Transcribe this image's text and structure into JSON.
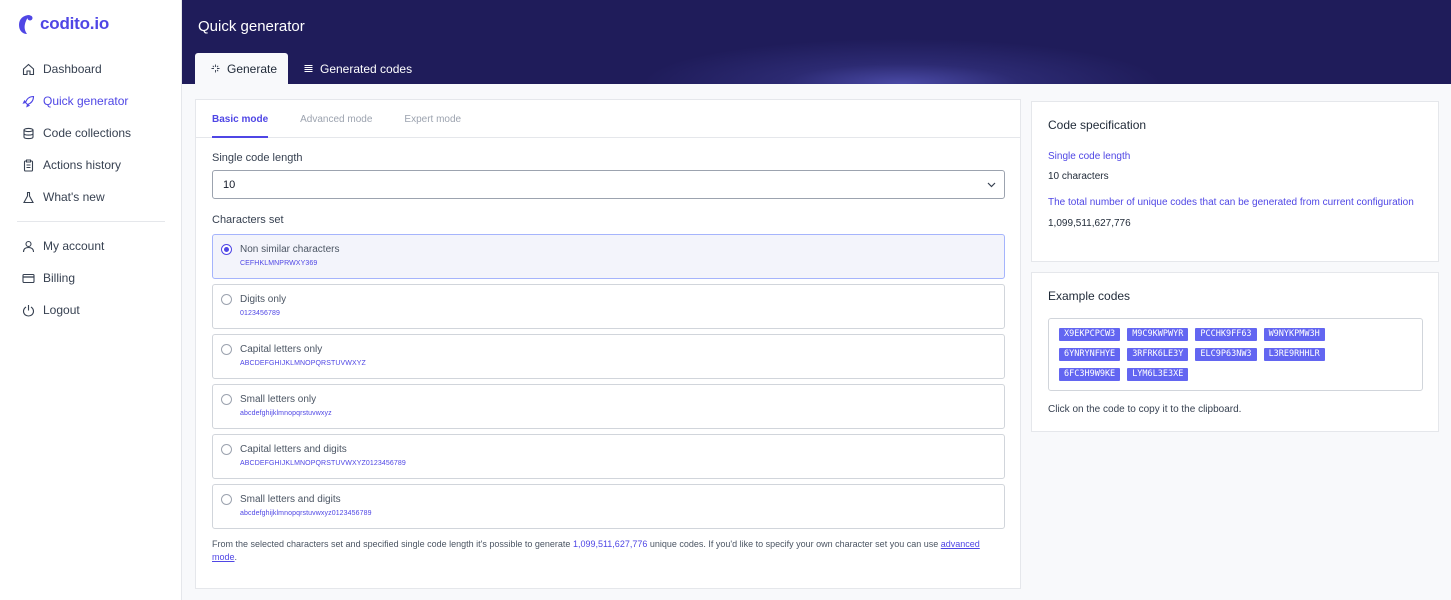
{
  "app": {
    "logo": "codito.io"
  },
  "sidebar": {
    "items": [
      {
        "label": "Dashboard",
        "icon": "home-icon"
      },
      {
        "label": "Quick generator",
        "icon": "rocket-icon",
        "active": true
      },
      {
        "label": "Code collections",
        "icon": "database-icon"
      },
      {
        "label": "Actions history",
        "icon": "clipboard-icon"
      },
      {
        "label": "What's new",
        "icon": "flask-icon"
      }
    ],
    "account_items": [
      {
        "label": "My account",
        "icon": "user-icon"
      },
      {
        "label": "Billing",
        "icon": "credit-card-icon"
      },
      {
        "label": "Logout",
        "icon": "power-icon"
      }
    ]
  },
  "header": {
    "title": "Quick generator",
    "tabs": [
      {
        "label": "Generate",
        "icon": "sparkle-icon",
        "active": true
      },
      {
        "label": "Generated codes",
        "icon": "list-icon"
      }
    ]
  },
  "generator": {
    "mode_tabs": [
      "Basic mode",
      "Advanced mode",
      "Expert mode"
    ],
    "length_label": "Single code length",
    "length_value": "10",
    "charset_label": "Characters set",
    "options": [
      {
        "title": "Non similar characters",
        "chars": "CEFHKLMNPRWXY369",
        "selected": true
      },
      {
        "title": "Digits only",
        "chars": "0123456789"
      },
      {
        "title": "Capital letters only",
        "chars": "ABCDEFGHIJKLMNOPQRSTUVWXYZ"
      },
      {
        "title": "Small letters only",
        "chars": "abcdefghijklmnopqrstuvwxyz"
      },
      {
        "title": "Capital letters and digits",
        "chars": "ABCDEFGHIJKLMNOPQRSTUVWXYZ0123456789"
      },
      {
        "title": "Small letters and digits",
        "chars": "abcdefghijklmnopqrstuvwxyz0123456789"
      }
    ],
    "footnote_pre": "From the selected characters set and specified single code length it's possible to generate ",
    "footnote_count": "1,099,511,627,776",
    "footnote_mid": " unique codes. If you'd like to specify your own character set you can use ",
    "footnote_link": "advanced mode",
    "footnote_post": "."
  },
  "spec": {
    "title": "Code specification",
    "length_label": "Single code length",
    "length_value": "10 characters",
    "total_label": "The total number of unique codes that can be generated from current configuration",
    "total_value": "1,099,511,627,776"
  },
  "examples": {
    "title": "Example codes",
    "codes": [
      "X9EKPCPCW3",
      "M9C9KWPWYR",
      "PCCHK9FF63",
      "W9NYKPMW3H",
      "6YNRYNFHYE",
      "3RFRK6LE3Y",
      "ELC9P63NW3",
      "L3RE9RHHLR",
      "6FC3H9W9KE",
      "LYM6L3E3XE"
    ],
    "hint": "Click on the code to copy it to the clipboard."
  },
  "colors": {
    "accent": "#4f46e5",
    "header_bg": "#1f1c5a",
    "code_bg": "#6366f1"
  }
}
